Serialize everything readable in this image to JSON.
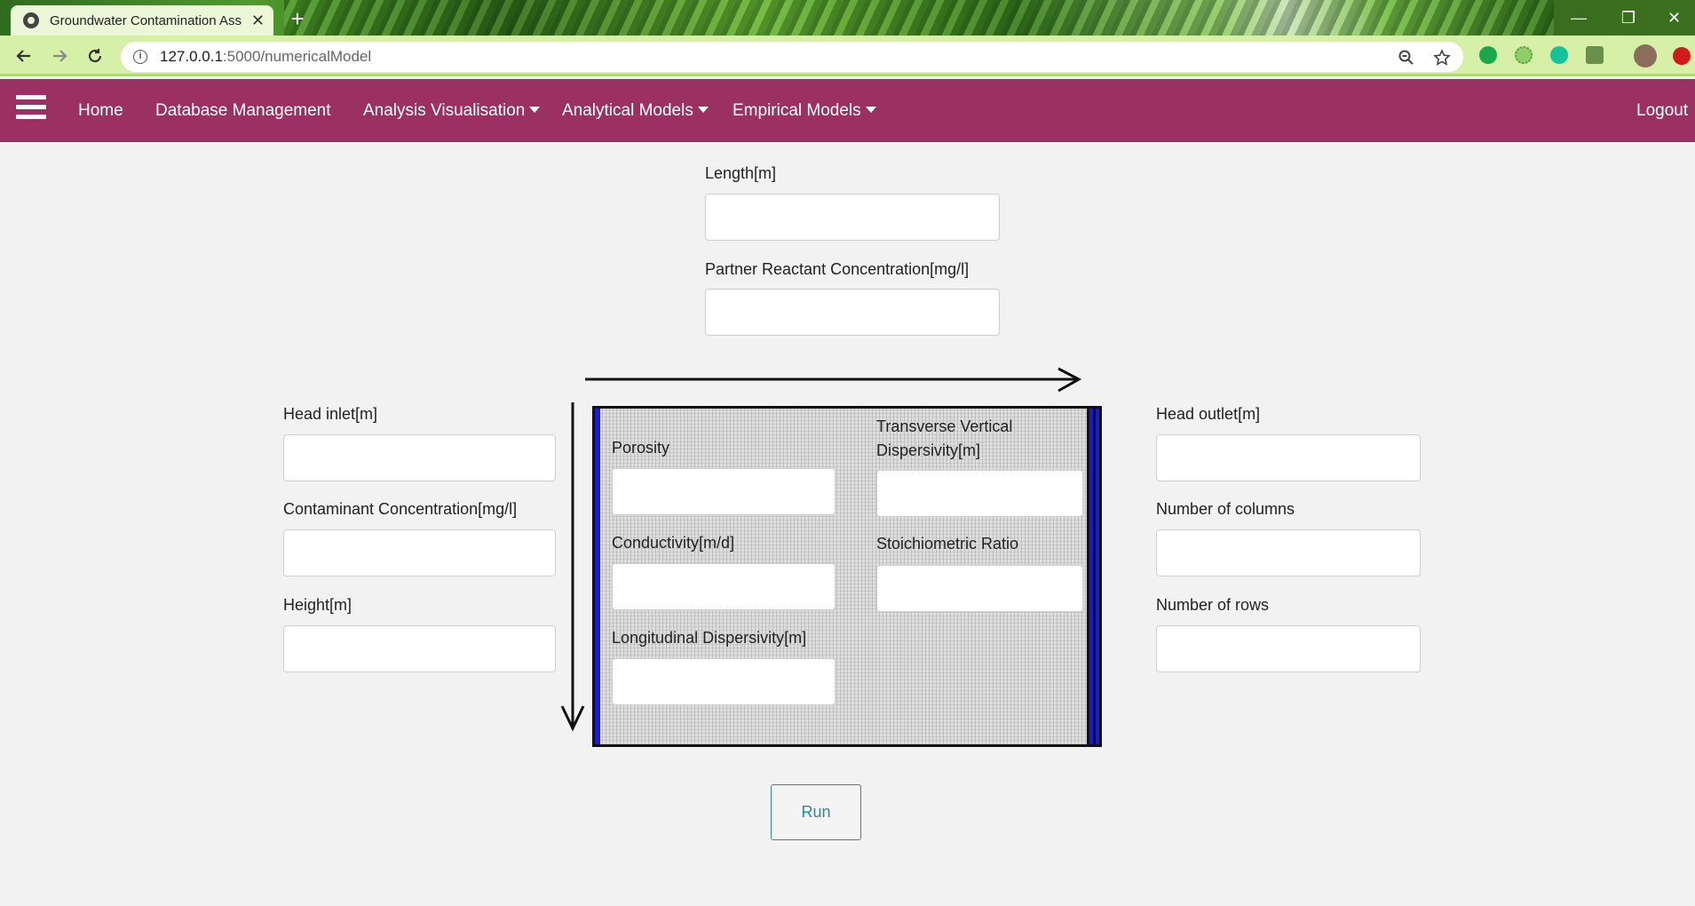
{
  "browser": {
    "tab_title": "Groundwater Contamination Ass",
    "tab_close": "✕",
    "new_tab": "+",
    "url_host": "127.0.0.1",
    "url_path": ":5000/numericalModel",
    "window_controls": {
      "minimize": "—",
      "restore": "❐",
      "close": "✕"
    }
  },
  "nav": {
    "home": "Home",
    "database": "Database Management",
    "analysis": "Analysis Visualisation",
    "analytical": "Analytical Models",
    "empirical": "Empirical Models",
    "logout": "Logout"
  },
  "form": {
    "length_label": "Length[m]",
    "partner_label": "Partner Reactant Concentration[mg/l]",
    "head_inlet_label": "Head inlet[m]",
    "contaminant_label": "Contaminant Concentration[mg/l]",
    "height_label": "Height[m]",
    "porosity_label": "Porosity",
    "transverse_label_line1": "Transverse Vertical",
    "transverse_label_line2": "Dispersivity[m]",
    "conductivity_label": "Conductivity[m/d]",
    "stoichiometric_label": "Stoichiometric Ratio",
    "longitudinal_label": "Longitudinal Dispersivity[m]",
    "head_outlet_label": "Head outlet[m]",
    "columns_label": "Number of columns",
    "rows_label": "Number of rows",
    "run_label": "Run"
  },
  "colors": {
    "nav_bg": "#9b3163",
    "run_accent": "#2b8a9a",
    "boundary_blue": "#1a1ad6"
  }
}
